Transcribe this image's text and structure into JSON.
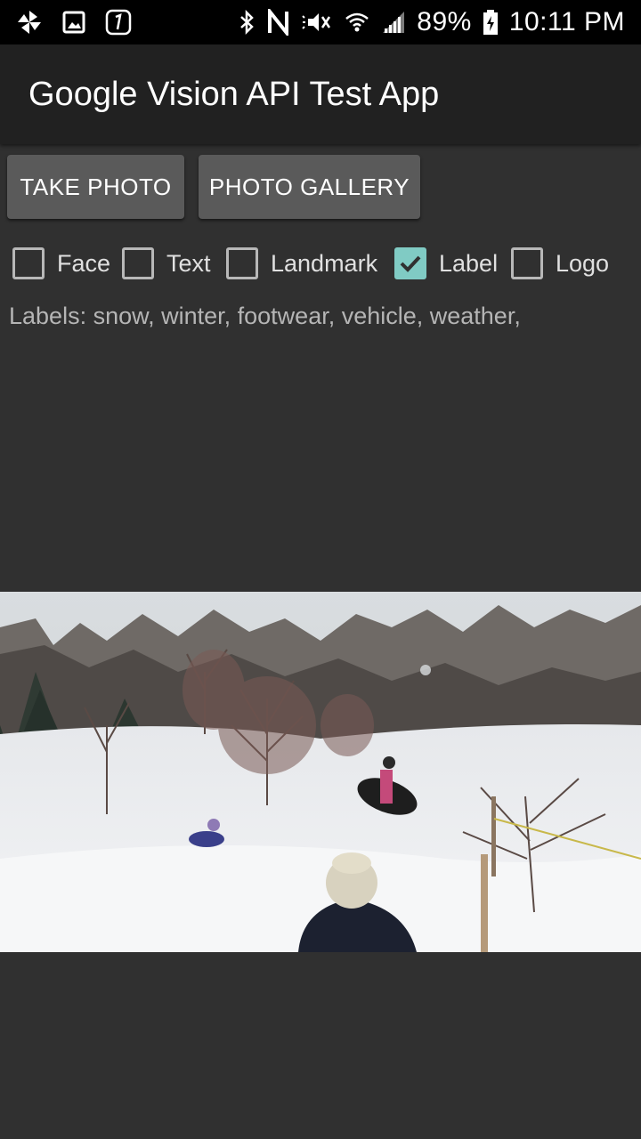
{
  "status_bar": {
    "battery_percent": "89%",
    "time": "10:11 PM",
    "icons_left": [
      "pinwheel-icon",
      "gallery-icon",
      "one-icon"
    ],
    "icons_right": [
      "bluetooth-icon",
      "nfc-icon",
      "mute-icon",
      "wifi-icon",
      "signal-icon",
      "battery-charging-icon"
    ]
  },
  "toolbar": {
    "title": "Google Vision API Test App"
  },
  "buttons": {
    "take_photo": "TAKE PHOTO",
    "photo_gallery": "PHOTO GALLERY"
  },
  "checkboxes": [
    {
      "label": "Face",
      "checked": false
    },
    {
      "label": "Text",
      "checked": false
    },
    {
      "label": "Landmark",
      "checked": false
    },
    {
      "label": "Label",
      "checked": true
    },
    {
      "label": "Logo",
      "checked": false
    }
  ],
  "result": {
    "text": "Labels:  snow, winter, footwear, vehicle, weather,"
  },
  "colors": {
    "background": "#303030",
    "toolbar": "#212121",
    "button": "#5a5a5a",
    "accent": "#80cbc4"
  }
}
